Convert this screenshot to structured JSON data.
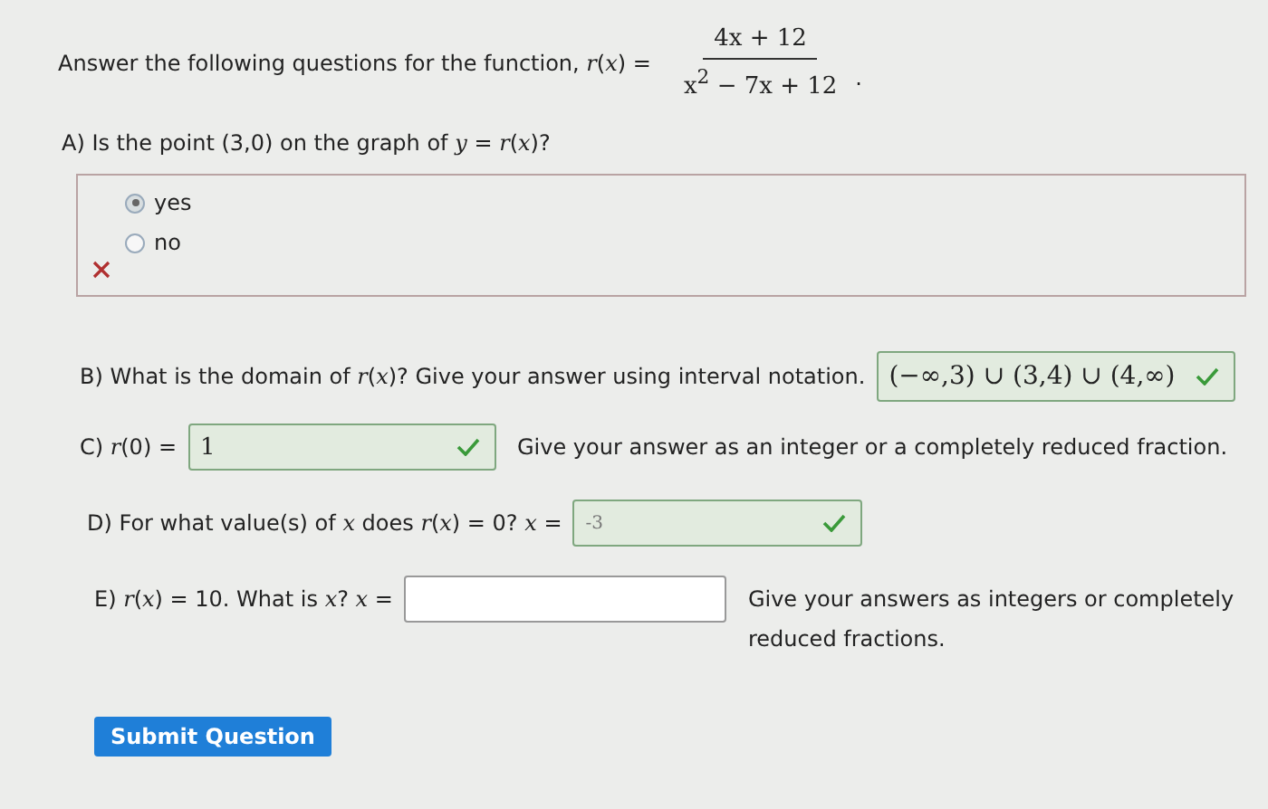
{
  "intro": {
    "text": "Answer the following questions for the function, *r*(*x*) =",
    "numerator": "4x + 12",
    "denominator": "x$^{2}$ − 7x + 12",
    "end": "."
  },
  "part_a": {
    "question": "A) Is the point (3,0) on the graph of *y* = *r*(*x*)?",
    "correct": false,
    "options": [
      {
        "label": "yes",
        "selected": true
      },
      {
        "label": "no",
        "selected": false
      }
    ]
  },
  "part_b": {
    "question": "B) What is the domain of *r*(*x*)? Give your answer using interval notation.",
    "answer": {
      "value": "(−∞,3) ∪ (3,4) ∪ (4,∞)",
      "correct": true
    }
  },
  "part_c": {
    "question": "C) *r*(0) =",
    "answer": {
      "value": "1",
      "correct": true
    },
    "hint": "Give your answer as an integer or a completely reduced fraction."
  },
  "part_d": {
    "question": "D) For what value(s) of *x* does *r*(*x*) = 0? *x* =",
    "answer": {
      "value": "-3",
      "correct": true
    }
  },
  "part_e": {
    "question": "E) *r*(*x*) = 10. What is *x*? *x* =",
    "hint": "Give your answers as integers or completely reduced fractions."
  },
  "submit_button": "Submit Question"
}
